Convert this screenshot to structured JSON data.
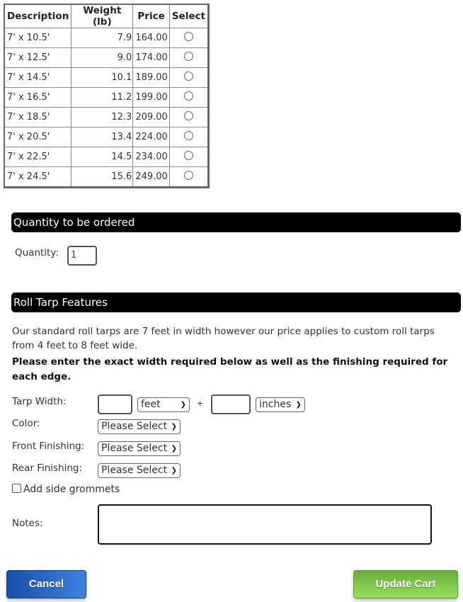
{
  "table": {
    "headers": [
      "Description",
      "Weight (lb)",
      "Price",
      "Select"
    ],
    "rows": [
      {
        "desc": "7' x 10.5'",
        "weight": "7.9",
        "price": "164.00"
      },
      {
        "desc": "7' x 12.5'",
        "weight": "9.0",
        "price": "174.00"
      },
      {
        "desc": "7' x 14.5'",
        "weight": "10.1",
        "price": "189.00"
      },
      {
        "desc": "7' x 16.5'",
        "weight": "11.2",
        "price": "199.00"
      },
      {
        "desc": "7' x 18.5'",
        "weight": "12.3",
        "price": "209.00"
      },
      {
        "desc": "7' x 20.5'",
        "weight": "13.4",
        "price": "224.00"
      },
      {
        "desc": "7' x 22.5'",
        "weight": "14.5",
        "price": "234.00"
      },
      {
        "desc": "7' x 24.5'",
        "weight": "15.6",
        "price": "249.00"
      }
    ]
  },
  "quantity": {
    "heading": "Quantity to be ordered",
    "label": "Quantity:",
    "value": "1"
  },
  "features": {
    "heading": "Roll Tarp Features",
    "intro": "Our standard roll tarps are 7 feet in width however our price applies to custom roll tarps from 4 feet to 8 feet wide.",
    "instruction": "Please enter the exact width required below as well as the finishing required for each edge.",
    "tarp_width_label": "Tarp Width:",
    "feet_unit": "feet",
    "plus": "+",
    "inches_unit": "inches",
    "color_label": "Color:",
    "front_label": "Front Finishing:",
    "rear_label": "Rear Finishing:",
    "select_placeholder": "Please Select",
    "grommets_label": "Add side grommets",
    "notes_label": "Notes:"
  },
  "buttons": {
    "cancel": "Cancel",
    "update": "Update Cart"
  },
  "colors": {
    "cancel": "#2a62c4",
    "update": "#7cc84a",
    "header_bar": "#000000"
  }
}
